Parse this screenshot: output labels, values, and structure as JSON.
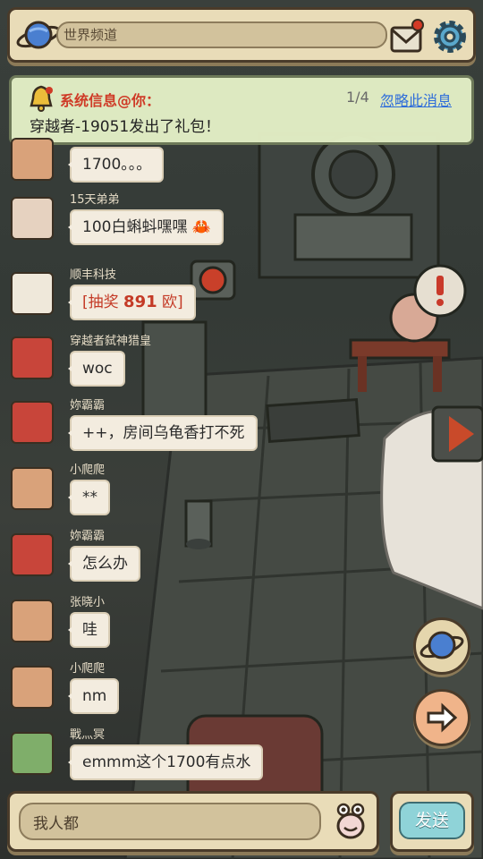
{
  "header": {
    "channel_label": "世界频道",
    "icons": [
      "planet-icon",
      "mail-icon",
      "gear-icon"
    ]
  },
  "notice": {
    "title": "系统信息@你：",
    "count": "1/4",
    "ignore_label": "忽略此消息",
    "body": "穿越者-19051发出了礼包！"
  },
  "messages": [
    {
      "name": "",
      "text": "1700。。。",
      "avatar": "cat-avatar"
    },
    {
      "name": "15天弟弟",
      "text": "100白蝌蚪嘿嘿",
      "avatar": "snail-avatar"
    },
    {
      "name": "顺丰科技",
      "prefix": "[抽奖 ",
      "number": "891",
      "suffix": " 欧]",
      "avatar": "crab-avatar"
    },
    {
      "name": "穿越者弑神猎皇",
      "text": "woc",
      "avatar": "demon-avatar"
    },
    {
      "name": "妳霸霸",
      "text": "++，房间乌龟香打不死",
      "avatar": "demon-avatar"
    },
    {
      "name": "小爬爬",
      "text": "**",
      "avatar": "cat-avatar"
    },
    {
      "name": "妳霸霸",
      "text": "怎么办",
      "avatar": "demon-avatar"
    },
    {
      "name": "张晓小",
      "text": "哇",
      "avatar": "cat-avatar"
    },
    {
      "name": "小爬爬",
      "text": "nm",
      "avatar": "cat-avatar"
    },
    {
      "name": "戰灬冥",
      "text": "emmm这个1700有点水",
      "avatar": "plant-avatar"
    }
  ],
  "footer": {
    "input_value": "我人都",
    "send_label": "发送"
  },
  "colors": {
    "panel": "#e9dcb8",
    "notice_bg": "#e3efc6",
    "highlight_red": "#d43a26",
    "link_blue": "#2e6fe0",
    "send_button": "#8fd3d8"
  }
}
